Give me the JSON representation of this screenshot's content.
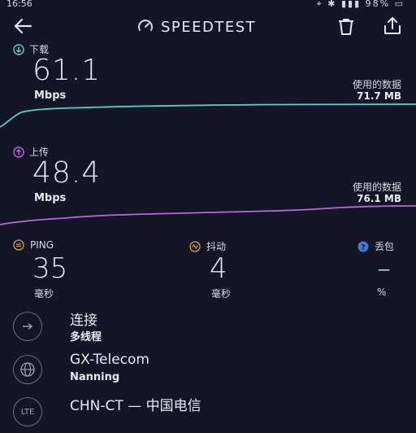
{
  "status": {
    "time": "16:56",
    "battery": "98%"
  },
  "header": {
    "title": "SPEEDTEST"
  },
  "download": {
    "label": "下载",
    "value": "61.1",
    "unit": "Mbps",
    "used_label": "使用的数据",
    "used_value": "71.7 MB",
    "color": "#58d3c6"
  },
  "upload": {
    "label": "上传",
    "value": "48.4",
    "unit": "Mbps",
    "used_label": "使用的数据",
    "used_value": "76.1 MB",
    "color": "#b36bd8"
  },
  "stats": {
    "ping": {
      "label": "PING",
      "value": "35",
      "unit": "毫秒"
    },
    "jitter": {
      "label": "抖动",
      "value": "4",
      "unit": "毫秒"
    },
    "loss": {
      "label": "丢包",
      "value": "–",
      "unit": "%"
    }
  },
  "info": [
    {
      "icon": "connections-icon",
      "title": "连接",
      "sub": "多线程"
    },
    {
      "icon": "globe-icon",
      "title": "GX-Telecom",
      "sub": "Nanning"
    },
    {
      "icon": "lte-icon",
      "icon_text": "LTE",
      "title": "CHN-CT — 中国电信",
      "sub": ""
    }
  ]
}
